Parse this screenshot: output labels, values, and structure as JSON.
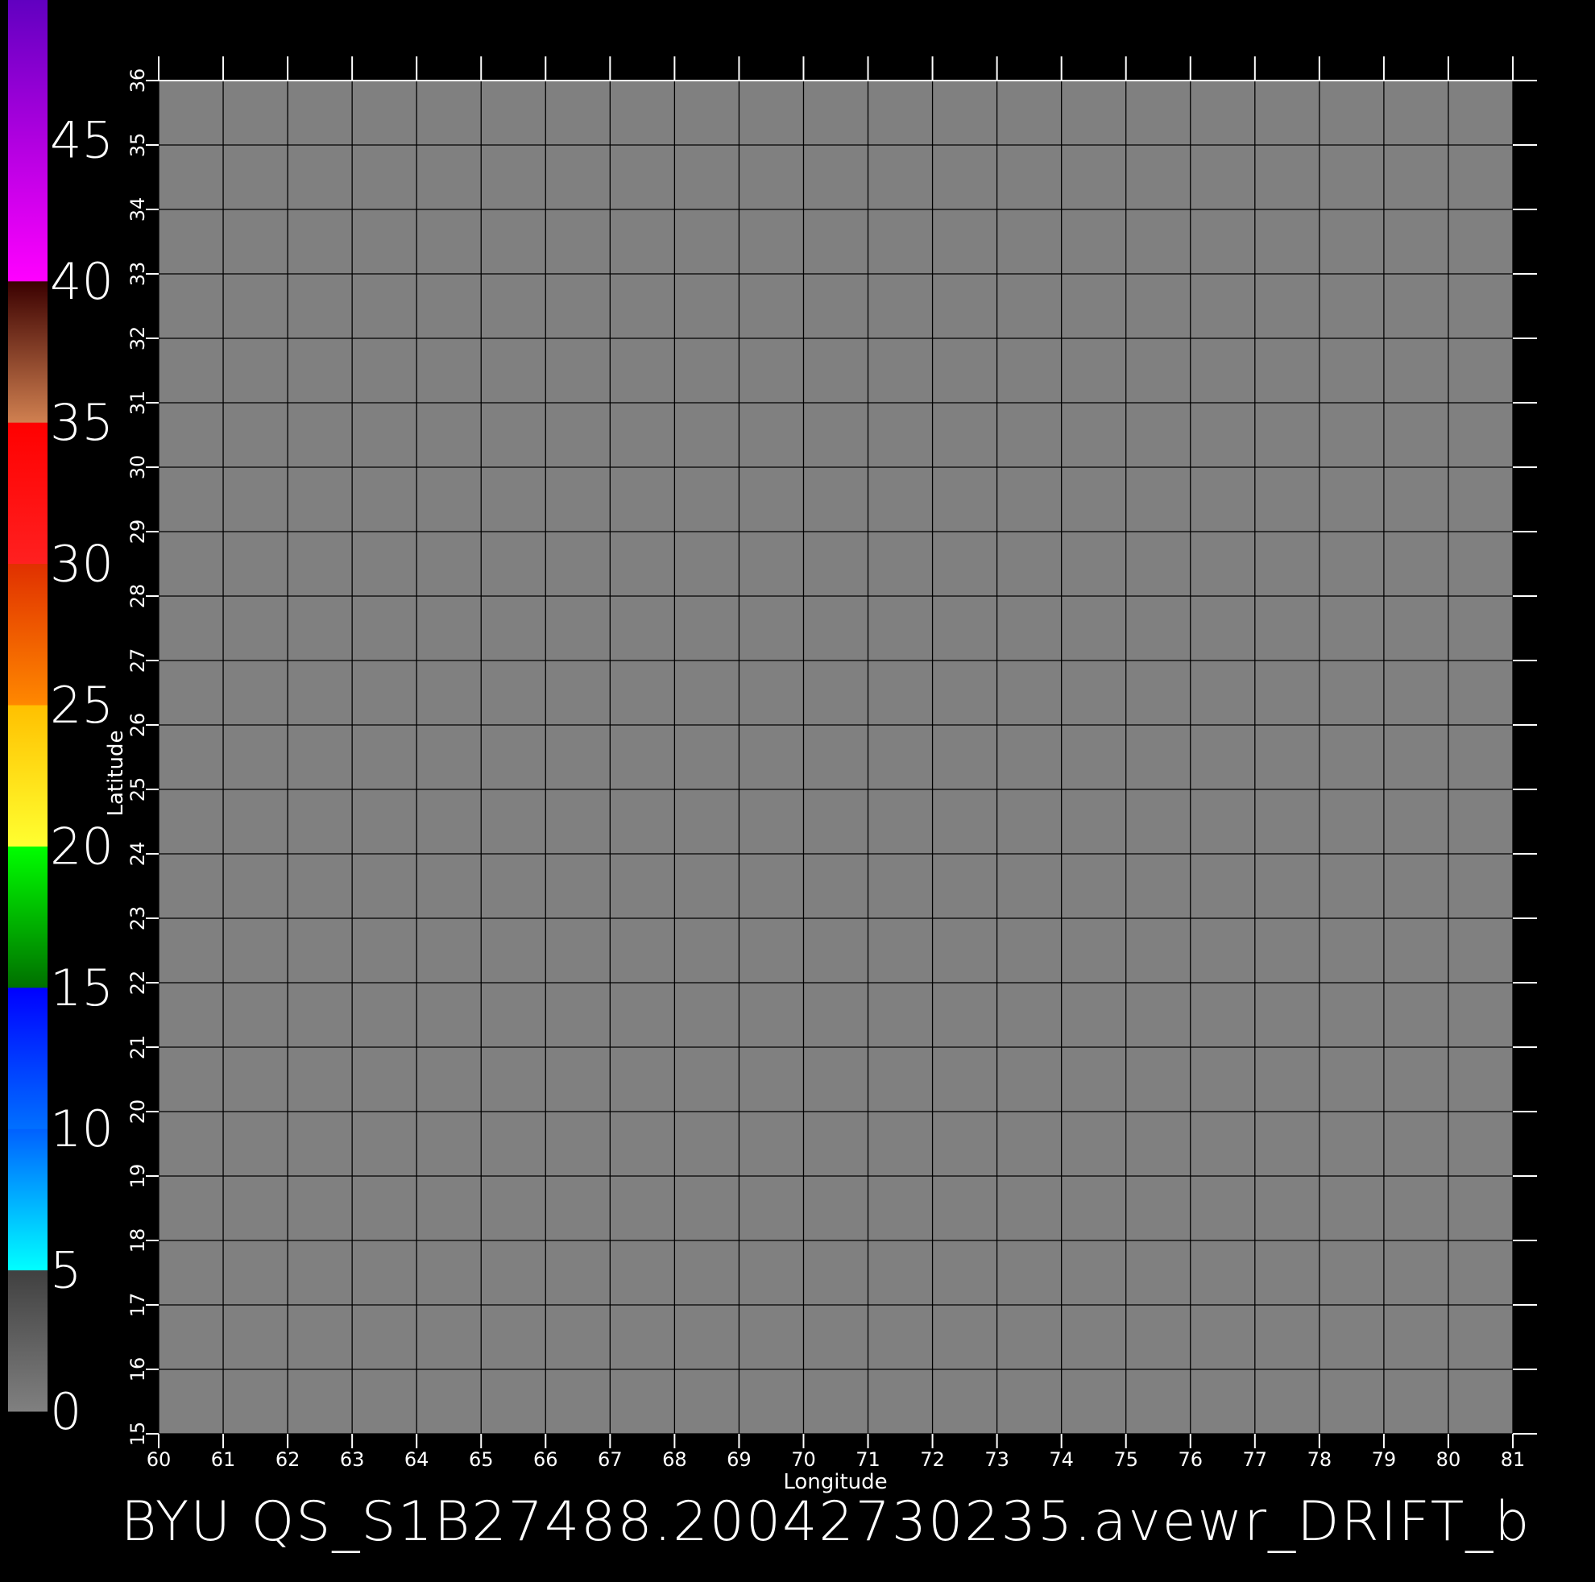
{
  "chart_data": {
    "type": "heatmap",
    "title": "BYU QS_S1B27488.20042730235.avewr_DRIFT_b",
    "xlabel": "Longitude",
    "ylabel": "Latitude",
    "xlim": [
      60,
      81
    ],
    "ylim": [
      15,
      36
    ],
    "x_ticks": [
      "60",
      "61",
      "62",
      "63",
      "64",
      "65",
      "66",
      "67",
      "68",
      "69",
      "70",
      "71",
      "72",
      "73",
      "74",
      "75",
      "76",
      "77",
      "78",
      "79",
      "80",
      "81"
    ],
    "y_ticks": [
      "15",
      "16",
      "17",
      "18",
      "19",
      "20",
      "21",
      "22",
      "23",
      "24",
      "25",
      "26",
      "27",
      "28",
      "29",
      "30",
      "31",
      "32",
      "33",
      "34",
      "35",
      "36"
    ],
    "grid": true,
    "field_value": "no data (uniform gray)",
    "colorbar": {
      "range": [
        0,
        50
      ],
      "labels": [
        "0",
        "5",
        "10",
        "15",
        "20",
        "25",
        "30",
        "35",
        "40",
        "45"
      ],
      "stops": [
        {
          "from": 0,
          "to": 5,
          "top": "#404040",
          "bottom": "#808080"
        },
        {
          "from": 5,
          "to": 10,
          "top": "#0060ff",
          "bottom": "#00ffff"
        },
        {
          "from": 10,
          "to": 15,
          "top": "#0000ff",
          "bottom": "#0070ff"
        },
        {
          "from": 15,
          "to": 20,
          "top": "#00ff00",
          "bottom": "#007000"
        },
        {
          "from": 20,
          "to": 25,
          "top": "#ffc000",
          "bottom": "#ffff30"
        },
        {
          "from": 25,
          "to": 30,
          "top": "#e03000",
          "bottom": "#ff8800"
        },
        {
          "from": 30,
          "to": 35,
          "top": "#ff0000",
          "bottom": "#ff2020"
        },
        {
          "from": 35,
          "to": 40,
          "top": "#3a0000",
          "bottom": "#d08050"
        },
        {
          "from": 40,
          "to": 50,
          "top": "#6000c0",
          "bottom": "#ff00ff"
        }
      ]
    },
    "colors": {
      "background": "#000000",
      "plot_fill": "#808080",
      "grid": "#000000",
      "text": "#ffffff"
    }
  }
}
